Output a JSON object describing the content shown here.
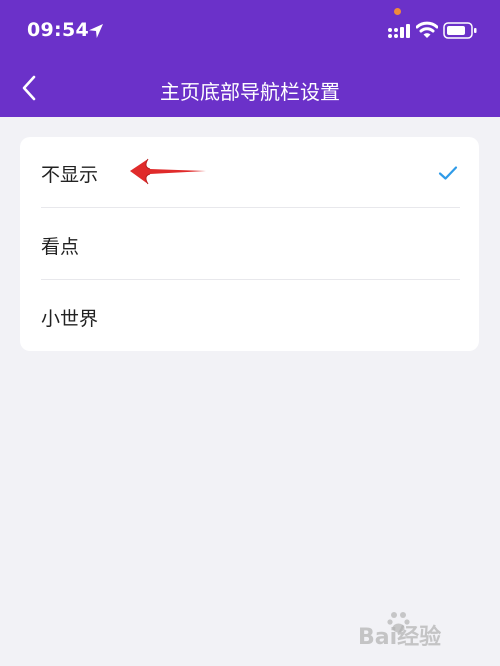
{
  "status_bar": {
    "time": "09:54",
    "icons": [
      "location-icon",
      "signal-icon",
      "wifi-icon",
      "battery-icon"
    ]
  },
  "header": {
    "title": "主页底部导航栏设置",
    "back_icon": "chevron-left-icon",
    "background_color": "#6b31c9"
  },
  "options": [
    {
      "label": "不显示",
      "selected": true
    },
    {
      "label": "看点",
      "selected": false
    },
    {
      "label": "小世界",
      "selected": false
    }
  ],
  "colors": {
    "accent": "#2f9be8",
    "arrow": "#e02b2b",
    "page_background": "#f2f2f6"
  },
  "watermark": {
    "text": "Bai经验",
    "icon": "paw-icon"
  }
}
